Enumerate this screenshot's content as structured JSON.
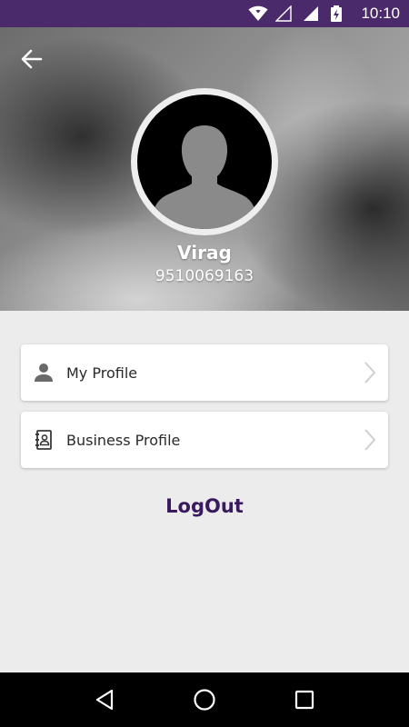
{
  "status_bar": {
    "time": "10:10",
    "icons": [
      "wifi-icon",
      "signal-icon",
      "signal-icon",
      "battery-icon"
    ],
    "background": "#4b2a6b"
  },
  "header": {
    "back_icon": "arrow-left-icon",
    "avatar_icon": "person-silhouette-icon",
    "name": "Virag",
    "phone": "9510069163"
  },
  "menu": {
    "items": [
      {
        "label": "My Profile",
        "icon": "person-icon",
        "trailing_icon": "chevron-right-icon"
      },
      {
        "label": "Business Profile",
        "icon": "contact-book-icon",
        "trailing_icon": "chevron-right-icon"
      }
    ]
  },
  "logout": {
    "label": "LogOut",
    "color": "#3a1a5e"
  },
  "nav_bar": {
    "buttons": [
      "back-triangle-icon",
      "home-circle-icon",
      "recents-square-icon"
    ]
  }
}
